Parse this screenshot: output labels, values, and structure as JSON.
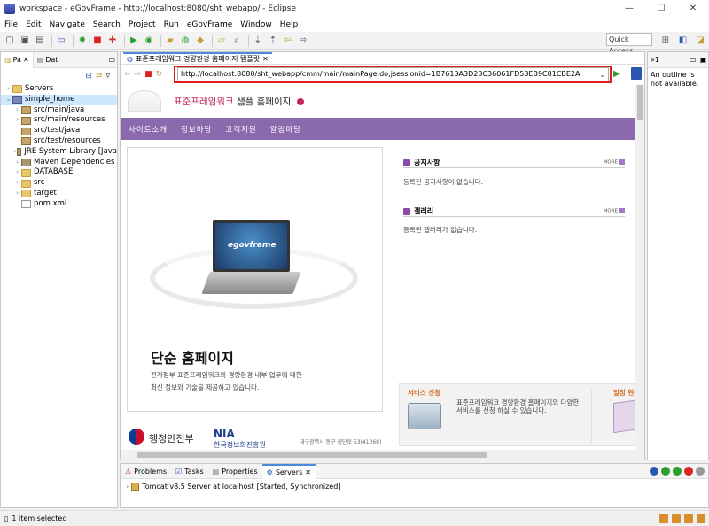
{
  "window": {
    "title": "workspace - eGovFrame - http://localhost:8080/sht_webapp/ - Eclipse",
    "min": "—",
    "max": "☐",
    "close": "✕"
  },
  "menu": [
    "File",
    "Edit",
    "Navigate",
    "Search",
    "Project",
    "Run",
    "eGovFrame",
    "Window",
    "Help"
  ],
  "toolbar": {
    "quick_access": "Quick Access"
  },
  "left_panel": {
    "tabs": [
      {
        "label": "Pa"
      },
      {
        "label": "Dat"
      }
    ],
    "tree": [
      {
        "label": "Servers",
        "indent": 0,
        "arrow": "›",
        "type": "folder"
      },
      {
        "label": "simple_home",
        "indent": 0,
        "arrow": "⌄",
        "type": "proj",
        "selected": true
      },
      {
        "label": "src/main/java",
        "indent": 1,
        "arrow": "›",
        "type": "pkg"
      },
      {
        "label": "src/main/resources",
        "indent": 1,
        "arrow": "›",
        "type": "pkg"
      },
      {
        "label": "src/test/java",
        "indent": 1,
        "arrow": "",
        "type": "pkg"
      },
      {
        "label": "src/test/resources",
        "indent": 1,
        "arrow": "",
        "type": "pkg"
      },
      {
        "label": "JRE System Library [Java",
        "indent": 1,
        "arrow": "›",
        "type": "jar"
      },
      {
        "label": "Maven Dependencies",
        "indent": 1,
        "arrow": "›",
        "type": "jar"
      },
      {
        "label": "DATABASE",
        "indent": 1,
        "arrow": "›",
        "type": "folder"
      },
      {
        "label": "src",
        "indent": 1,
        "arrow": "›",
        "type": "folder"
      },
      {
        "label": "target",
        "indent": 1,
        "arrow": "›",
        "type": "folder"
      },
      {
        "label": "pom.xml",
        "indent": 1,
        "arrow": "",
        "type": "file"
      }
    ]
  },
  "editor": {
    "tab_label": "표준프레임워크 경량환경 홈페이지 템플릿",
    "url": "http://localhost:8080/sht_webapp/cmm/main/mainPage.do;jsessionid=1B7613A3D23C36061FD53EB9C81CBE2A"
  },
  "site": {
    "title_brand": "표준프레임워크",
    "title_rest": " 샘플 홈페이지",
    "nav": [
      "사이트소개",
      "정보마당",
      "고객지원",
      "알림마당"
    ],
    "laptop_label": "egovframe",
    "hero_title": "단순 홈페이지",
    "hero_desc_1": "전자정부 표준프레임워크의 경량환경 내부 업무에 대한",
    "hero_desc_2": "최신 정보와 기술을 제공하고 있습니다.",
    "notice": {
      "title": "공지사항",
      "more": "MORE",
      "empty": "등록된 공지사항이 없습니다."
    },
    "gallery": {
      "title": "갤러리",
      "more": "MORE",
      "empty": "등록된 갤러리가 없습니다."
    },
    "service": {
      "title": "서비스 신청",
      "text": "표준프레임워크 경량환경 홈페이지의 다양한 서비스를 신청 하실 수 있습니다."
    },
    "calendar": {
      "title": "일정 현황"
    },
    "footer": {
      "mois": "행정안전부",
      "nia": "NIA",
      "nia_full": "한국정보화진흥원",
      "addr": "대구광역시 동구 첨단로 53(41068)"
    }
  },
  "outline": {
    "tab": "»1",
    "message": "An outline is not available."
  },
  "bottom": {
    "tabs": [
      "Problems",
      "Tasks",
      "Properties",
      "Servers"
    ],
    "server": "Tomcat v8.5 Server at localhost",
    "server_state": "[Started, Synchronized]"
  },
  "status": {
    "text": "1 item selected"
  }
}
